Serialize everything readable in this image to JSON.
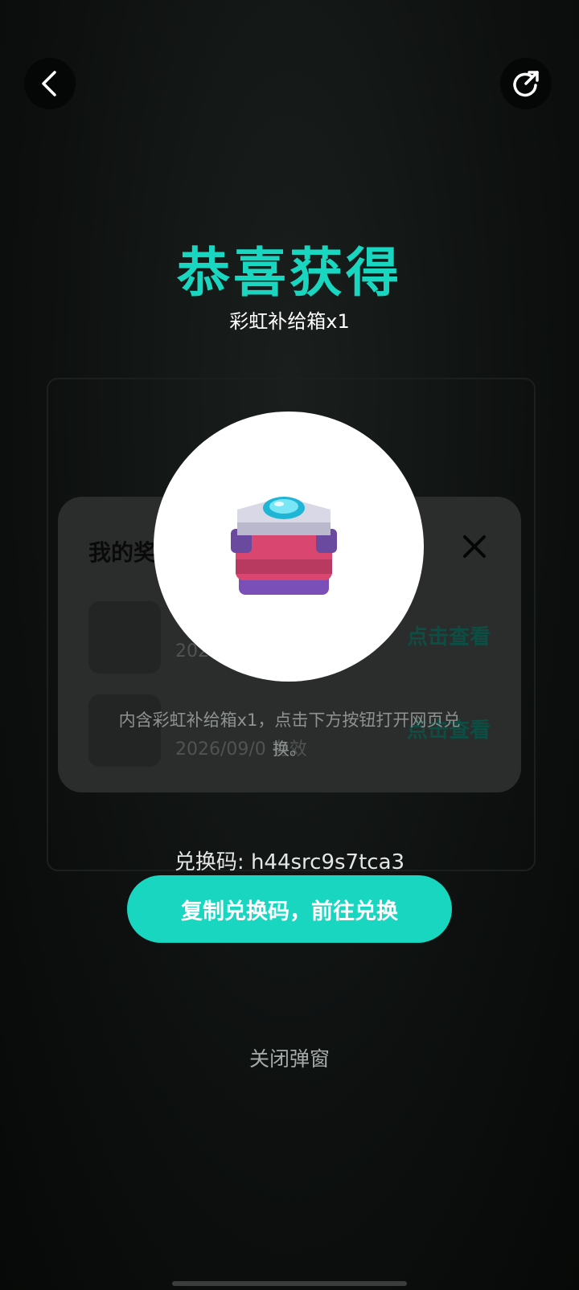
{
  "header": {
    "congrats_title": "恭喜获得",
    "prize_subtitle": "彩虹补给箱x1"
  },
  "prize": {
    "icon": "rainbow-supply-chest-icon",
    "description": "内含彩虹补给箱x1，点击下方按钮打开网页兑换。"
  },
  "redeem": {
    "code_line": "兑换码: h44src9s7tca3",
    "copy_button_label": "复制兑换码，前往兑换",
    "close_label": "关闭弹窗"
  },
  "rewards_panel": {
    "title": "我的奖",
    "items": [
      {
        "name": "",
        "date": "202",
        "link": "点击查看"
      },
      {
        "name": "",
        "date": "2026/09/0  有效",
        "link": "点击查看"
      }
    ]
  },
  "nav": {
    "back_icon": "chevron-left-icon",
    "share_icon": "share-icon"
  },
  "colors": {
    "accent": "#18d6c0",
    "overlay": "#0b0d0c"
  }
}
